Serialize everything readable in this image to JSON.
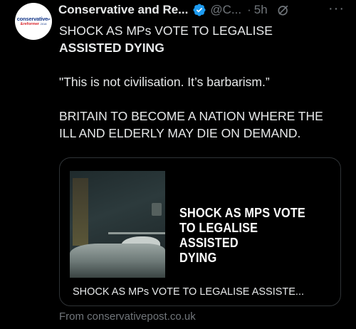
{
  "account": {
    "avatar_line1": "conservative",
    "avatar_line1_mark": "pl",
    "avatar_line2": "&reformer",
    "avatar_year": "2018",
    "name": "Conservative and Re...",
    "handle": "@C...",
    "separator": "·",
    "time": "5h",
    "more": "···"
  },
  "post": {
    "line1": "SHOCK AS MPs VOTE TO LEGALISE",
    "line2": "ASSISTED DYING",
    "quote": "\"This is not civilisation. It’s barbarism.”",
    "line3": "BRITAIN TO BECOME A NATION WHERE THE",
    "line4": "ILL AND ELDERLY MAY DIE ON DEMAND."
  },
  "card": {
    "headline": [
      "SHOCK AS MPS VOTE",
      "TO LEGALISE ASSISTED",
      "DYING"
    ],
    "caption": "SHOCK AS MPs VOTE TO LEGALISE ASSISTE...",
    "source": "From conservativepost.co.uk"
  },
  "colors": {
    "background": "#000000",
    "text": "#e7e9ea",
    "muted": "#71767b",
    "verified": "#1d9bf0",
    "border": "#2f3336"
  }
}
